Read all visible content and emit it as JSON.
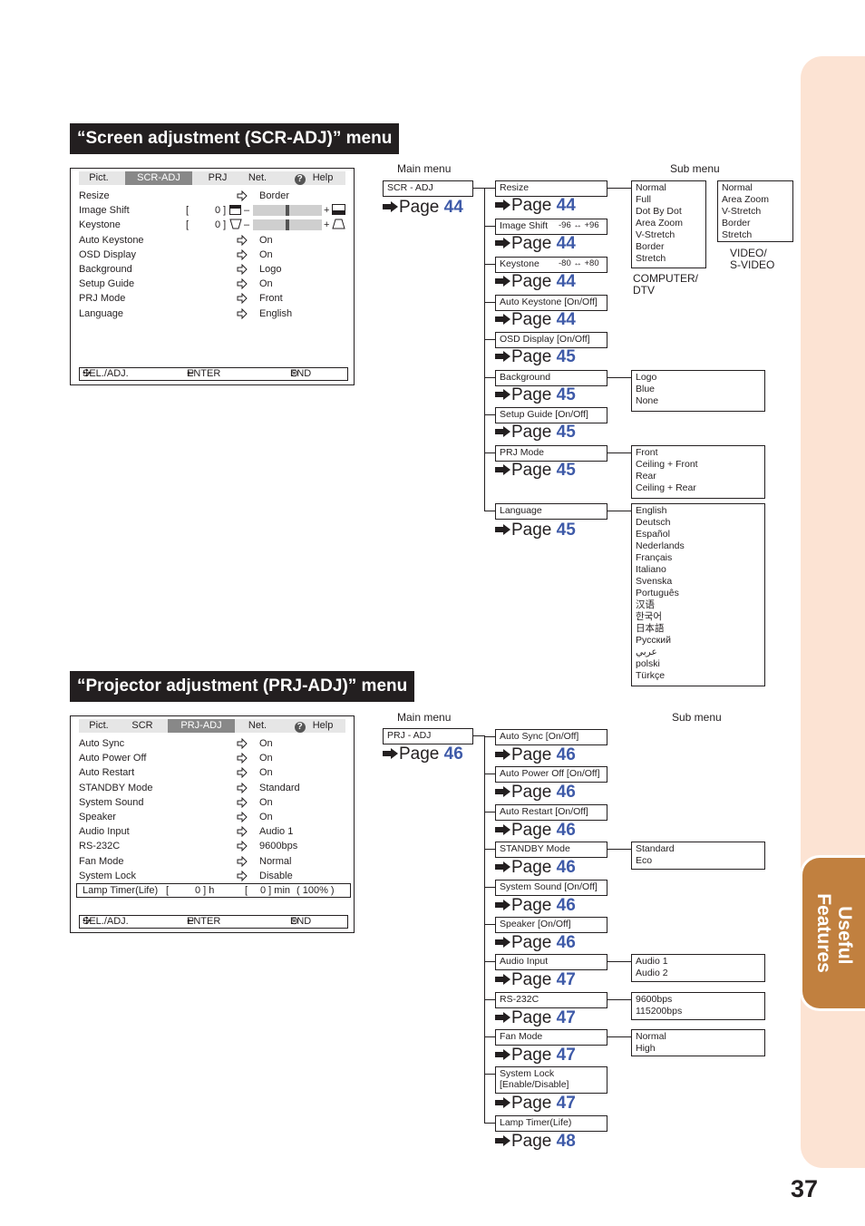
{
  "page_number": "37",
  "side_tab": {
    "line1": "Useful",
    "line2": "Features",
    "color": "#c1803f",
    "bg": "#fce3d3"
  },
  "page_ref_prefix": "Page",
  "page_ref_color": "#3e5aa8",
  "scr": {
    "title": "“Screen adjustment (SCR-ADJ)” menu",
    "osd": {
      "tabs": [
        "Pict.",
        "SCR-ADJ",
        "PRJ",
        "Net.",
        "Help"
      ],
      "active_tab": "SCR-ADJ",
      "rows": [
        {
          "label": "Resize",
          "value": "Border"
        },
        {
          "label": "Image Shift",
          "bracket": "[",
          "num": "0 ]",
          "slider_value": 0,
          "slider_range": [
            -96,
            96
          ]
        },
        {
          "label": "Keystone",
          "bracket": "[",
          "num": "0 ]",
          "slider_value": 0,
          "slider_range": [
            -80,
            80
          ]
        },
        {
          "label": "Auto Keystone",
          "value": "On"
        },
        {
          "label": "OSD Display",
          "value": "On"
        },
        {
          "label": "Background",
          "value": "Logo"
        },
        {
          "label": "Setup Guide",
          "value": "On"
        },
        {
          "label": "PRJ Mode",
          "value": "Front"
        },
        {
          "label": "Language",
          "value": "English"
        }
      ],
      "footer": {
        "sel": "SEL./ADJ.",
        "enter": "ENTER",
        "end": "END"
      }
    },
    "tree": {
      "main_menu_label": "Main menu",
      "sub_menu_label": "Sub menu",
      "root": {
        "label": "SCR - ADJ",
        "page": "44"
      },
      "items": [
        {
          "label": "Resize",
          "page": "44"
        },
        {
          "label": "Image Shift",
          "range": "-96 ↔ +96",
          "page": "44"
        },
        {
          "label": "Keystone",
          "range": "-80 ↔ +80",
          "page": "44"
        },
        {
          "label": "Auto Keystone [On/Off]",
          "page": "44"
        },
        {
          "label": "OSD Display [On/Off]",
          "page": "45"
        },
        {
          "label": "Background",
          "page": "45"
        },
        {
          "label": "Setup Guide [On/Off]",
          "page": "45"
        },
        {
          "label": "PRJ Mode",
          "page": "45"
        },
        {
          "label": "Language",
          "page": "45"
        }
      ],
      "resize_computer": {
        "options": [
          "Normal",
          "Full",
          "Dot By Dot",
          "Area Zoom",
          "V-Stretch",
          "Border",
          "Stretch"
        ],
        "caption1": "COMPUTER/",
        "caption2": "DTV"
      },
      "resize_video": {
        "options": [
          "Normal",
          "Area Zoom",
          "V-Stretch",
          "Border",
          "Stretch"
        ],
        "caption1": "VIDEO/",
        "caption2": "S-VIDEO"
      },
      "background_options": [
        "Logo",
        "Blue",
        "None"
      ],
      "prj_mode_options": [
        "Front",
        "Ceiling + Front",
        "Rear",
        "Ceiling + Rear"
      ],
      "language_options": [
        "English",
        "Deutsch",
        "Español",
        "Nederlands",
        "Français",
        "Italiano",
        "Svenska",
        "Português",
        "汉语",
        "한국어",
        "日本語",
        "Русский",
        "عربي",
        "polski",
        "Türkçe"
      ]
    }
  },
  "prj": {
    "title": "“Projector adjustment (PRJ-ADJ)” menu",
    "osd": {
      "tabs": [
        "Pict.",
        "SCR",
        "PRJ-ADJ",
        "Net.",
        "Help"
      ],
      "active_tab": "PRJ-ADJ",
      "rows": [
        {
          "label": "Auto Sync",
          "value": "On"
        },
        {
          "label": "Auto Power Off",
          "value": "On"
        },
        {
          "label": "Auto Restart",
          "value": "On"
        },
        {
          "label": "STANDBY Mode",
          "value": "Standard"
        },
        {
          "label": "System Sound",
          "value": "On"
        },
        {
          "label": "Speaker",
          "value": "On"
        },
        {
          "label": "Audio Input",
          "value": "Audio 1"
        },
        {
          "label": "RS-232C",
          "value": "9600bps"
        },
        {
          "label": "Fan Mode",
          "value": "Normal"
        },
        {
          "label": "System Lock",
          "value": "Disable"
        }
      ],
      "lamp": {
        "label": "Lamp Timer(Life)",
        "b1": "[",
        "hours": "0 ] h",
        "b2": "[",
        "minutes": "0 ] min",
        "life": "( 100% )"
      },
      "footer": {
        "sel": "SEL./ADJ.",
        "enter": "ENTER",
        "end": "END"
      }
    },
    "tree": {
      "main_menu_label": "Main menu",
      "sub_menu_label": "Sub menu",
      "root": {
        "label": "PRJ - ADJ",
        "page": "46"
      },
      "items": [
        {
          "label": "Auto Sync [On/Off]",
          "page": "46"
        },
        {
          "label": "Auto Power Off [On/Off]",
          "page": "46"
        },
        {
          "label": "Auto Restart [On/Off]",
          "page": "46"
        },
        {
          "label": "STANDBY Mode",
          "page": "46"
        },
        {
          "label": "System Sound [On/Off]",
          "page": "46"
        },
        {
          "label": "Speaker [On/Off]",
          "page": "46"
        },
        {
          "label": "Audio Input",
          "page": "47"
        },
        {
          "label": "RS-232C",
          "page": "47"
        },
        {
          "label": "Fan Mode",
          "page": "47"
        },
        {
          "label": "System Lock",
          "label2": "[Enable/Disable]",
          "page": "47"
        },
        {
          "label": "Lamp Timer(Life)",
          "page": "48"
        }
      ],
      "standby_options": [
        "Standard",
        "Eco"
      ],
      "audio_input_options": [
        "Audio 1",
        "Audio 2"
      ],
      "rs232c_options": [
        "9600bps",
        "115200bps"
      ],
      "fan_mode_options": [
        "Normal",
        "High"
      ]
    }
  }
}
